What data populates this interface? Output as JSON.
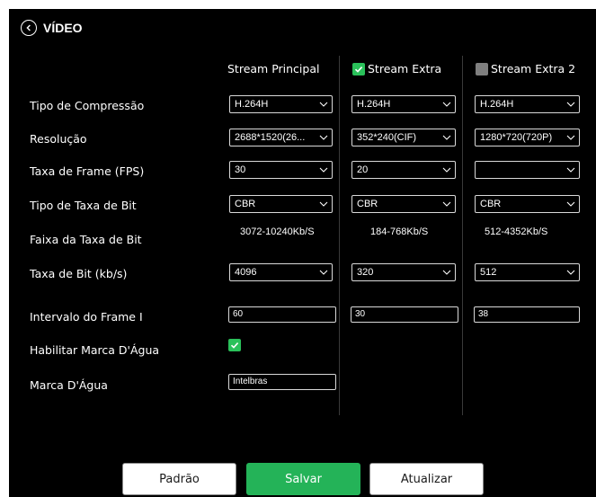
{
  "header": {
    "title": "VÍDEO",
    "back_icon": "chevron-left-circle-icon"
  },
  "columns": {
    "principal": {
      "label": "Stream Principal"
    },
    "extra": {
      "label": "Stream Extra",
      "enabled": true
    },
    "extra2": {
      "label": "Stream Extra 2",
      "enabled": false
    }
  },
  "rows": {
    "compression": "Tipo de Compressão",
    "resolution": "Resolução",
    "fps": "Taxa de Frame (FPS)",
    "bitrate_type": "Tipo de Taxa de Bit",
    "bitrate_range": "Faixa da Taxa de Bit",
    "bitrate": "Taxa de Bit (kb/s)",
    "iframe": "Intervalo do Frame I",
    "watermark_enable": "Habilitar Marca D'Água",
    "watermark": "Marca D'Água"
  },
  "values": {
    "principal": {
      "compression": "H.264H",
      "resolution": "2688*1520(26...",
      "fps": "30",
      "bitrate_type": "CBR",
      "bitrate_range": "3072-10240Kb/S",
      "bitrate": "4096",
      "iframe": "60"
    },
    "extra": {
      "compression": "H.264H",
      "resolution": "352*240(CIF)",
      "fps": "20",
      "bitrate_type": "CBR",
      "bitrate_range": "184-768Kb/S",
      "bitrate": "320",
      "iframe": "30"
    },
    "extra2": {
      "compression": "H.264H",
      "resolution": "1280*720(720P)",
      "fps": "",
      "bitrate_type": "CBR",
      "bitrate_range": "512-4352Kb/S",
      "bitrate": "512",
      "iframe": "38"
    }
  },
  "watermark": {
    "enabled": true,
    "text": "Intelbras"
  },
  "buttons": {
    "default": "Padrão",
    "save": "Salvar",
    "refresh": "Atualizar"
  },
  "colors": {
    "background": "#000000",
    "accent_green": "#24b358",
    "checkbox_green": "#2ac15a",
    "checkbox_disabled": "#7f7f7f"
  }
}
